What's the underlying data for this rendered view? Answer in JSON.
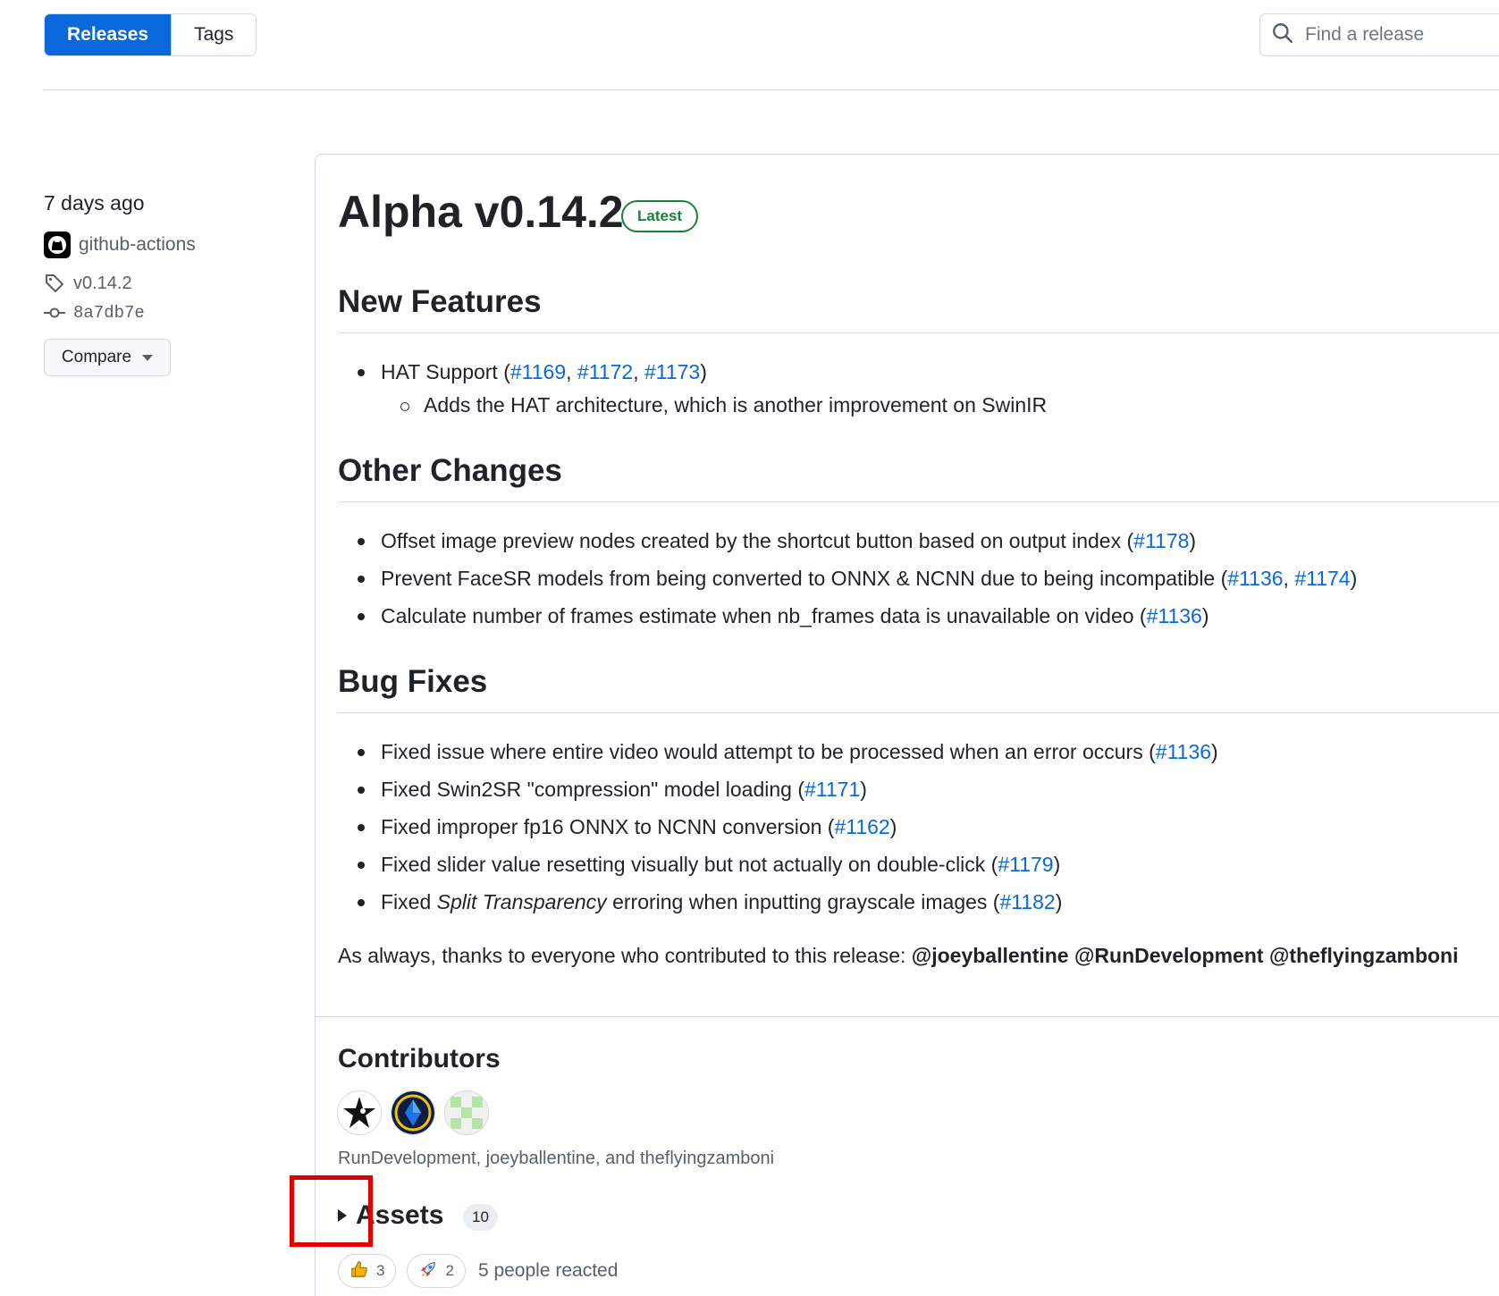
{
  "nav": {
    "tabs": [
      {
        "label": "Releases",
        "active": true
      },
      {
        "label": "Tags",
        "active": false
      }
    ],
    "search_placeholder": "Find a release"
  },
  "sidebar": {
    "date": "7 days ago",
    "author": "github-actions",
    "tag": "v0.14.2",
    "commit": "8a7db7e",
    "compare_label": "Compare"
  },
  "release": {
    "title": "Alpha v0.14.2",
    "badge": "Latest",
    "sections": {
      "new_features": {
        "heading": "New Features",
        "hat_text": "HAT Support (",
        "hat_links": [
          "#1169",
          "#1172",
          "#1173"
        ],
        "hat_sub": "Adds the HAT architecture, which is another improvement on SwinIR"
      },
      "other_changes": {
        "heading": "Other Changes",
        "item1_text": "Offset image preview nodes created by the shortcut button based on output index (",
        "item1_link": "#1178",
        "item2_text": "Prevent FaceSR models from being converted to ONNX & NCNN due to being incompatible (",
        "item2_links": [
          "#1136",
          "#1174"
        ],
        "item3_text": "Calculate number of frames estimate when nb_frames data is unavailable on video (",
        "item3_link": "#1136"
      },
      "bug_fixes": {
        "heading": "Bug Fixes",
        "items": [
          {
            "text": "Fixed issue where entire video would attempt to be processed when an error occurs (",
            "link": "#1136"
          },
          {
            "text": "Fixed Swin2SR \"compression\" model loading (",
            "link": "#1171"
          },
          {
            "text": "Fixed improper fp16 ONNX to NCNN conversion (",
            "link": "#1162"
          },
          {
            "text": "Fixed slider value resetting visually but not actually on double-click (",
            "link": "#1179"
          }
        ],
        "item5_prefix": "Fixed ",
        "item5_em": "Split Transparency",
        "item5_suffix": " erroring when inputting grayscale images (",
        "item5_link": "#1182"
      }
    },
    "thanks_text": "As always, thanks to everyone who contributed to this release: ",
    "thanks_users": [
      "@joeyballentine",
      "@RunDevelopment",
      "@theflyingzamboni"
    ]
  },
  "contributors": {
    "title": "Contributors",
    "names": "RunDevelopment, joeyballentine, and theflyingzamboni"
  },
  "assets": {
    "label": "Assets",
    "count": "10"
  },
  "reactions": {
    "thumbs_count": "3",
    "rocket_count": "2",
    "summary": "5 people reacted"
  }
}
